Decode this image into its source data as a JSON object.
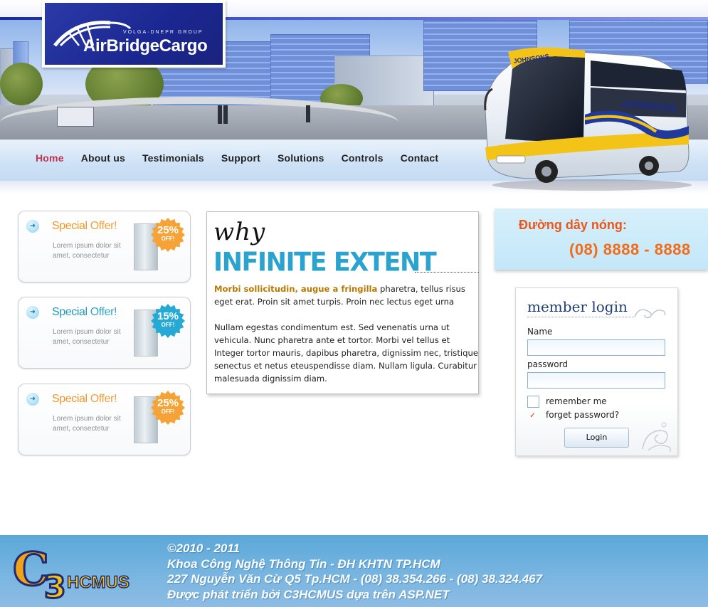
{
  "brand": {
    "group": "VOLGA·DNEPR GROUP",
    "name": "AirBridgeCargo"
  },
  "nav": [
    {
      "label": "Home",
      "active": true
    },
    {
      "label": "About us"
    },
    {
      "label": "Testimonials"
    },
    {
      "label": "Support"
    },
    {
      "label": "Solutions"
    },
    {
      "label": "Controls"
    },
    {
      "label": "Contact"
    }
  ],
  "bus": {
    "brand": "JOHNSONS"
  },
  "offers": [
    {
      "title_a": "Special",
      "title_b": "Offer!",
      "desc": "Lorem ipsum dolor sit amet, consectetur",
      "percent": "25%",
      "off": "OFF!",
      "accent": "#f0962a",
      "badge": "#f5a236"
    },
    {
      "title_a": "Special",
      "title_b": "Offer!",
      "desc": "Lorem ipsum dolor sit amet, consectetur",
      "percent": "15%",
      "off": "OFF!",
      "accent": "#1f99bf",
      "badge": "#27a9d6"
    },
    {
      "title_a": "Special",
      "title_b": "Offer!",
      "desc": "Lorem ipsum dolor sit amet, consectetur",
      "percent": "25%",
      "off": "OFF!",
      "accent": "#f0962a",
      "badge": "#f5a236"
    }
  ],
  "why": {
    "small": "why",
    "big": "INFINITE EXTENT",
    "highlight": "Morbi sollicitudin, augue a fringilla",
    "p1_rest": " pharetra, tellus risus eget erat. Proin sit amet turpis. Proin nec lectus eget urna",
    "p2": "Nullam egestas condimentum est. Sed venenatis urna ut vehicula. Nunc pharetra ante et tortor. Morbi vel tellus et Integer tortor mauris, dapibus pharetra, dignissim nec, tristique senectus et netus eteuspendisse diam. Nullam ligula. Curabitur malesuada dignissim diam."
  },
  "hotline": {
    "label": "Đường dây nóng:",
    "number": "(08) 8888 - 8888"
  },
  "login": {
    "title": "member login",
    "name_label": "Name",
    "password_label": "password",
    "remember": "remember me",
    "forgot": "forget password?",
    "button": "Login"
  },
  "footer": {
    "logo_c": "C",
    "logo_3": "3",
    "logo_text": "HCMUS",
    "lines": [
      "©2010 - 2011",
      "Khoa Công Nghệ Thông Tin - ĐH KHTN TP.HCM",
      "227 Nguyễn Văn Cừ Q5 Tp.HCM - (08) 38.354.266 - (08) 38.324.467",
      "Được phát triển bởi C3HCMUS dựa trên ASP.NET"
    ]
  }
}
